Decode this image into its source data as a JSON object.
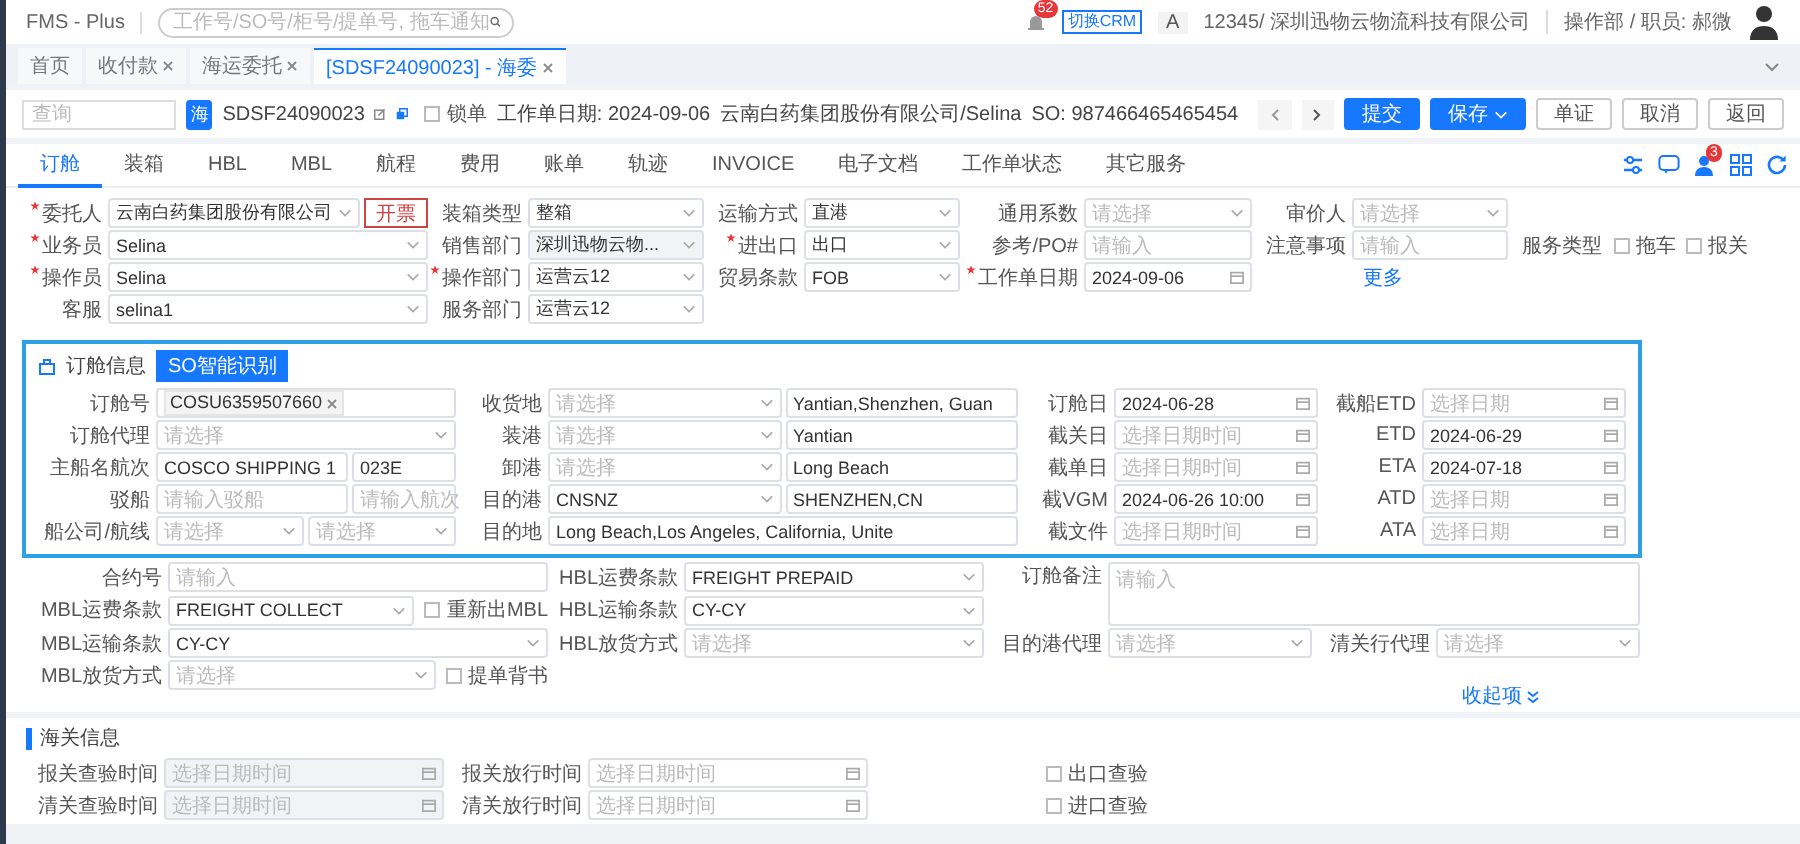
{
  "header": {
    "app_name": "FMS - Plus",
    "search": {
      "placeholder": "工作号/SO号/柜号/提单号, 拖车通知"
    },
    "notifications": "52",
    "crm_button": "切换CRM",
    "font_toggle": "A",
    "company": "12345/ 深圳迅物云物流科技有限公司",
    "user": "操作部 / 职员: 郝微"
  },
  "tabs": [
    {
      "label": "首页",
      "closable": false,
      "selected": false
    },
    {
      "label": "收付款",
      "closable": true,
      "selected": false
    },
    {
      "label": "海运委托",
      "closable": true,
      "selected": false
    },
    {
      "label": "[SDSF24090023] - 海委",
      "closable": true,
      "selected": true
    }
  ],
  "toolbar": {
    "search": {
      "placeholder": "查询"
    },
    "mode_badge": "海",
    "job_number": "SDSF24090023",
    "lock": {
      "label": "锁单",
      "checked": false
    },
    "job_date": "工作单日期: 2024-09-06",
    "client": "云南白药集团股份有限公司/Selina",
    "so": "SO: 987466465465454",
    "buttons": [
      {
        "label": "提交",
        "kind": "primary"
      },
      {
        "label": "保存",
        "kind": "dropdown"
      },
      {
        "label": "单证",
        "kind": "plain"
      },
      {
        "label": "取消",
        "kind": "plain"
      },
      {
        "label": "返回",
        "kind": "plain"
      }
    ]
  },
  "section_tabs": [
    {
      "label": "订舱",
      "selected": true
    },
    {
      "label": "装箱",
      "selected": false
    },
    {
      "label": "HBL",
      "selected": false
    },
    {
      "label": "MBL",
      "selected": false
    },
    {
      "label": "航程",
      "selected": false
    },
    {
      "label": "费用",
      "selected": false
    },
    {
      "label": "账单",
      "selected": false
    },
    {
      "label": "轨迹",
      "selected": false
    },
    {
      "label": "INVOICE",
      "selected": false
    },
    {
      "label": "电子文档",
      "selected": false
    },
    {
      "label": "工作单状态",
      "selected": false
    },
    {
      "label": "其它服务",
      "selected": false
    }
  ],
  "team_badge": "3",
  "order_form": {
    "rows": [
      [
        {
          "label": "委托人",
          "required": true,
          "parts": [
            {
              "kind": "select",
              "value": "云南白药集团股份有限公司"
            },
            {
              "kind": "button",
              "label": "开票"
            }
          ]
        },
        {
          "label": "装箱类型",
          "required": false,
          "parts": [
            {
              "kind": "select",
              "value": "整箱"
            }
          ]
        },
        {
          "label": "运输方式",
          "required": false,
          "parts": [
            {
              "kind": "select",
              "value": "直港"
            }
          ]
        },
        {
          "label": "通用系数",
          "required": false,
          "parts": [
            {
              "kind": "select",
              "placeholder": "请选择"
            }
          ]
        },
        {
          "label": "审价人",
          "required": false,
          "parts": [
            {
              "kind": "select",
              "placeholder": "请选择"
            }
          ]
        }
      ],
      [
        {
          "label": "业务员",
          "required": true,
          "parts": [
            {
              "kind": "select",
              "value": "Selina"
            }
          ]
        },
        {
          "label": "销售部门",
          "required": false,
          "parts": [
            {
              "kind": "select",
              "value": "深圳迅物云物...",
              "disabled": true
            }
          ]
        },
        {
          "label": "进出口",
          "required": true,
          "parts": [
            {
              "kind": "select",
              "value": "出口"
            }
          ]
        },
        {
          "label": "参考/PO#",
          "required": false,
          "parts": [
            {
              "kind": "input",
              "placeholder": "请输入"
            }
          ]
        },
        {
          "label": "注意事项",
          "required": false,
          "parts": [
            {
              "kind": "input",
              "placeholder": "请输入"
            }
          ]
        },
        {
          "label": "服务类型",
          "required": false,
          "parts": [
            {
              "kind": "check",
              "label": "拖车",
              "checked": false
            },
            {
              "kind": "check",
              "label": "报关",
              "checked": false
            }
          ]
        }
      ],
      [
        {
          "label": "操作员",
          "required": true,
          "parts": [
            {
              "kind": "select",
              "value": "Selina"
            }
          ]
        },
        {
          "label": "操作部门",
          "required": true,
          "parts": [
            {
              "kind": "select",
              "value": "运营云12"
            }
          ]
        },
        {
          "label": "贸易条款",
          "required": false,
          "parts": [
            {
              "kind": "select",
              "value": "FOB"
            }
          ]
        },
        {
          "label": "工作单日期",
          "required": true,
          "parts": [
            {
              "kind": "date",
              "value": "2024-09-06"
            }
          ]
        },
        {
          "kind": "link",
          "label": "更多"
        }
      ],
      [
        {
          "label": "客服",
          "required": false,
          "parts": [
            {
              "kind": "select",
              "value": "selina1"
            }
          ]
        },
        {
          "label": "服务部门",
          "required": false,
          "parts": [
            {
              "kind": "select",
              "value": "运营云12"
            }
          ]
        }
      ]
    ]
  },
  "booking": {
    "title": "订舱信息",
    "ocr_button": "SO智能识别",
    "rows": [
      [
        {
          "label": "订舱号",
          "parts": [
            {
              "kind": "tags",
              "tags": [
                "COSU6359507660"
              ]
            }
          ]
        },
        {
          "label": "收货地",
          "parts": [
            {
              "kind": "select",
              "placeholder": "请选择"
            },
            {
              "kind": "input",
              "value": "Yantian,Shenzhen, Guan"
            }
          ]
        },
        {
          "label": "订舱日",
          "parts": [
            {
              "kind": "date",
              "value": "2024-06-28"
            }
          ]
        },
        {
          "label": "截船ETD",
          "parts": [
            {
              "kind": "date",
              "placeholder": "选择日期"
            }
          ]
        }
      ],
      [
        {
          "label": "订舱代理",
          "parts": [
            {
              "kind": "select",
              "placeholder": "请选择"
            }
          ]
        },
        {
          "label": "装港",
          "parts": [
            {
              "kind": "select",
              "placeholder": "请选择"
            },
            {
              "kind": "input",
              "value": "Yantian"
            }
          ]
        },
        {
          "label": "截关日",
          "parts": [
            {
              "kind": "date",
              "placeholder": "选择日期时间"
            }
          ]
        },
        {
          "label": "ETD",
          "parts": [
            {
              "kind": "date",
              "value": "2024-06-29"
            }
          ]
        }
      ],
      [
        {
          "label": "主船名航次",
          "parts": [
            {
              "kind": "input",
              "value": "COSCO SHIPPING 1"
            },
            {
              "kind": "input",
              "value": "023E"
            }
          ]
        },
        {
          "label": "卸港",
          "parts": [
            {
              "kind": "select",
              "placeholder": "请选择"
            },
            {
              "kind": "input",
              "value": "Long Beach"
            }
          ]
        },
        {
          "label": "截单日",
          "parts": [
            {
              "kind": "date",
              "placeholder": "选择日期时间"
            }
          ]
        },
        {
          "label": "ETA",
          "parts": [
            {
              "kind": "date",
              "value": "2024-07-18"
            }
          ]
        }
      ],
      [
        {
          "label": "驳船",
          "parts": [
            {
              "kind": "input",
              "placeholder": "请输入驳船"
            },
            {
              "kind": "input",
              "placeholder": "请输入航次"
            }
          ]
        },
        {
          "label": "目的港",
          "parts": [
            {
              "kind": "select",
              "value": "CNSNZ"
            },
            {
              "kind": "input",
              "value": "SHENZHEN,CN"
            }
          ]
        },
        {
          "label": "截VGM",
          "parts": [
            {
              "kind": "date",
              "value": "2024-06-26 10:00"
            }
          ]
        },
        {
          "label": "ATD",
          "parts": [
            {
              "kind": "date",
              "placeholder": "选择日期"
            }
          ]
        }
      ],
      [
        {
          "label": "船公司/航线",
          "parts": [
            {
              "kind": "select",
              "placeholder": "请选择"
            },
            {
              "kind": "select",
              "placeholder": "请选择"
            }
          ]
        },
        {
          "label": "目的地",
          "parts": [
            {
              "kind": "input",
              "value": "Long Beach,Los Angeles, California, Unite"
            }
          ]
        },
        {
          "label": "截文件",
          "parts": [
            {
              "kind": "date",
              "placeholder": "选择日期时间"
            }
          ]
        },
        {
          "label": "ATA",
          "parts": [
            {
              "kind": "date",
              "placeholder": "选择日期"
            }
          ]
        }
      ]
    ]
  },
  "shipping": {
    "rows": [
      [
        {
          "label": "合约号",
          "parts": [
            {
              "kind": "input",
              "placeholder": "请输入"
            }
          ]
        },
        {
          "label": "HBL运费条款",
          "parts": [
            {
              "kind": "select",
              "value": "FREIGHT PREPAID"
            }
          ]
        },
        {
          "label": "订舱备注",
          "parts": [
            {
              "kind": "textarea",
              "placeholder": "请输入"
            }
          ]
        }
      ],
      [
        {
          "label": "MBL运费条款",
          "parts": [
            {
              "kind": "select",
              "value": "FREIGHT COLLECT"
            },
            {
              "kind": "check",
              "label": "重新出MBL",
              "checked": false
            }
          ]
        },
        {
          "label": "HBL运输条款",
          "parts": [
            {
              "kind": "select",
              "value": "CY-CY"
            }
          ]
        }
      ],
      [
        {
          "label": "MBL运输条款",
          "parts": [
            {
              "kind": "select",
              "value": "CY-CY"
            }
          ]
        },
        {
          "label": "HBL放货方式",
          "parts": [
            {
              "kind": "select",
              "placeholder": "请选择"
            }
          ]
        },
        {
          "label": "目的港代理",
          "parts": [
            {
              "kind": "select",
              "placeholder": "请选择"
            }
          ]
        },
        {
          "label": "清关行代理",
          "parts": [
            {
              "kind": "select",
              "placeholder": "请选择"
            }
          ]
        }
      ],
      [
        {
          "label": "MBL放货方式",
          "parts": [
            {
              "kind": "select",
              "placeholder": "请选择"
            },
            {
              "kind": "check",
              "label": "提单背书",
              "checked": false
            }
          ]
        }
      ]
    ],
    "collapse_link": "收起项"
  },
  "customs": {
    "title": "海关信息",
    "rows": [
      [
        {
          "label": "报关查验时间",
          "parts": [
            {
              "kind": "date",
              "placeholder": "选择日期时间",
              "disabled": true
            }
          ]
        },
        {
          "label": "报关放行时间",
          "parts": [
            {
              "kind": "date",
              "placeholder": "选择日期时间"
            }
          ]
        },
        {
          "parts": [
            {
              "kind": "check",
              "label": "出口查验",
              "checked": false
            }
          ]
        }
      ],
      [
        {
          "label": "清关查验时间",
          "parts": [
            {
              "kind": "date",
              "placeholder": "选择日期时间",
              "disabled": true
            }
          ]
        },
        {
          "label": "清关放行时间",
          "parts": [
            {
              "kind": "date",
              "placeholder": "选择日期时间"
            }
          ]
        },
        {
          "parts": [
            {
              "kind": "check",
              "label": "进口查验",
              "checked": false
            }
          ]
        }
      ]
    ]
  }
}
